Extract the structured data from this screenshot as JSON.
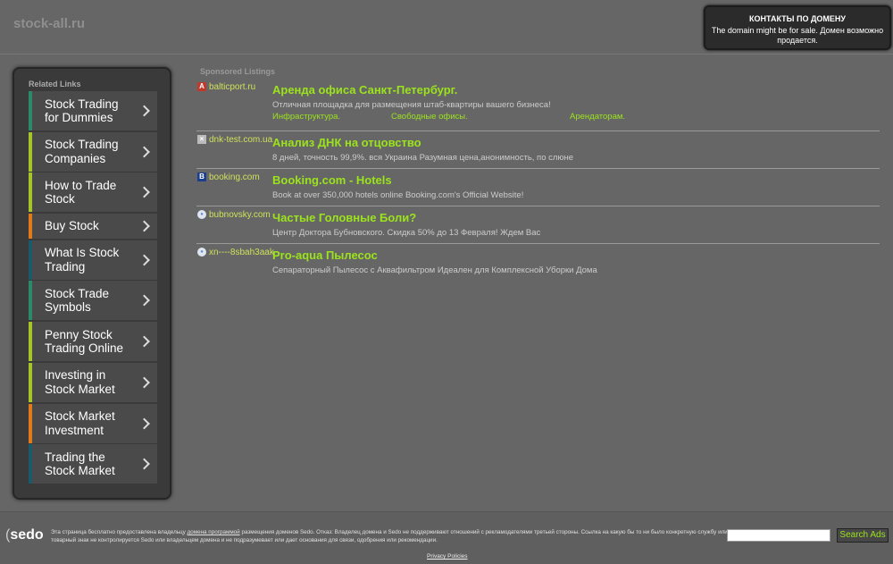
{
  "header": {
    "site_name": "stock-all.ru"
  },
  "contact": {
    "title": "КОНТАКТЫ ПО ДОМЕНУ",
    "text": "The domain might be for sale. Домен возможно продается."
  },
  "sidebar": {
    "title": "Related Links",
    "items": [
      {
        "label": "Stock Trading for Dummies",
        "accent": "#2c8a69"
      },
      {
        "label": "Stock Trading Companies",
        "accent": "#a7c52a"
      },
      {
        "label": "How to Trade Stock",
        "accent": "#a7c52a"
      },
      {
        "label": "Buy Stock",
        "accent": "#e07a1a"
      },
      {
        "label": "What Is Stock Trading",
        "accent": "#1a5a6a"
      },
      {
        "label": "Stock Trade Symbols",
        "accent": "#2c8a69"
      },
      {
        "label": "Penny Stock Trading Online",
        "accent": "#a7c52a"
      },
      {
        "label": "Investing in Stock Market",
        "accent": "#a7c52a"
      },
      {
        "label": "Stock Market Investment",
        "accent": "#e07a1a"
      },
      {
        "label": "Trading the Stock Market",
        "accent": "#1a5a6a"
      }
    ]
  },
  "sponsored": {
    "title": "Sponsored Listings",
    "listings": [
      {
        "icon": "pdf-icon",
        "icon_color": "#c0392b",
        "icon_glyph": "A",
        "domain": "balticport.ru",
        "title": "Аренда офиса Санкт-Петербург.",
        "desc": "Отличная площадка для размещения штаб-квартиры вашего бизнеса!",
        "sublinks": [
          "Инфраструктура.",
          "Свободные офисы.",
          "Арендаторам."
        ]
      },
      {
        "icon": "broken-image-icon",
        "icon_color": "#bbbbbb",
        "icon_glyph": "×",
        "domain": "dnk-test.com.ua",
        "title": "Анализ ДНК на отцовство",
        "desc": "8 дней, точность 99,9%. вся Украина Разумная цена,анонимность, по слюне",
        "sublinks": []
      },
      {
        "icon": "booking-icon",
        "icon_color": "#1b3f8f",
        "icon_glyph": "B",
        "domain": "booking.com",
        "title": "Booking.com - Hotels",
        "desc": "Book at over 350,000 hotels online Booking.com's Official Website!",
        "sublinks": []
      },
      {
        "icon": "globe-icon",
        "icon_color": "#dfe6f2",
        "icon_glyph": "●",
        "domain": "bubnovsky.com",
        "title": "Частые Головные Боли?",
        "desc": "Центр Доктора Бубновского. Скидка 50% до 13 Февраля! Ждем Вас",
        "sublinks": []
      },
      {
        "icon": "globe-icon",
        "icon_color": "#dfe6f2",
        "icon_glyph": "●",
        "domain": "xn----8sbah3aak",
        "title": "Pro-aqua Пылесос",
        "desc": "Сепараторный Пылесос с Аквафильтром Идеален для Комплексной Уборки Дома",
        "sublinks": []
      }
    ]
  },
  "footer": {
    "logo": "sedo",
    "text_before_link": "Эта страница бесплатно предоставлена владельцу ",
    "link_text": "домена программой",
    "text_after_link": " размещения доменов Sedo. Отказ: Владелец домена и Sedo не поддерживают отношений с рекламодателями третьей стороны. Ссылка на какую бы то ни было конкретную службу или товарный знак не контролируется Sedo или владельцем домена и не подразумевает или дает основания для связи, одобрения или рекомендации.",
    "search_button": "Search Ads",
    "search_placeholder": "",
    "privacy": "Privacy Policies"
  }
}
